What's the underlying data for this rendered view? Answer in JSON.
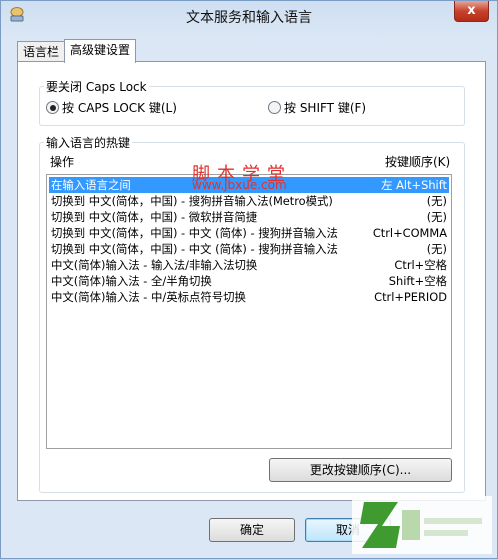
{
  "window": {
    "title": "文本服务和输入语言",
    "close_glyph": "x"
  },
  "tabs": [
    {
      "label": "语言栏",
      "active": false
    },
    {
      "label": "高级键设置",
      "active": true
    }
  ],
  "capslock": {
    "legend": "要关闭 Caps Lock",
    "options": [
      {
        "label": "按 CAPS LOCK 键(L)",
        "checked": true
      },
      {
        "label": "按 SHIFT 键(F)",
        "checked": false
      }
    ]
  },
  "hotkeys": {
    "legend": "输入语言的热键",
    "col_action": "操作",
    "col_key": "按键顺序(K)",
    "rows": [
      {
        "action": "在输入语言之间",
        "key": "左 Alt+Shift",
        "selected": true
      },
      {
        "action": "切换到 中文(简体，中国) - 搜狗拼音输入法(Metro模式)",
        "key": "(无)"
      },
      {
        "action": "切换到 中文(简体，中国) - 微软拼音简捷",
        "key": "(无)"
      },
      {
        "action": "切换到 中文(简体，中国) - 中文 (简体) - 搜狗拼音输入法",
        "key": "Ctrl+COMMA"
      },
      {
        "action": "切换到 中文(简体，中国) - 中文 (简体) - 搜狗拼音输入法",
        "key": "(无)"
      },
      {
        "action": "中文(简体)输入法 - 输入法/非输入法切换",
        "key": "Ctrl+空格"
      },
      {
        "action": "中文(简体)输入法 - 全/半角切换",
        "key": "Shift+空格"
      },
      {
        "action": "中文(简体)输入法 - 中/英标点符号切换",
        "key": "Ctrl+PERIOD"
      }
    ],
    "change_button": "更改按键顺序(C)..."
  },
  "buttons": {
    "ok": "确定",
    "cancel": "取消"
  },
  "watermark": {
    "text": "脚本学堂",
    "url": "www.jbxue.com"
  },
  "colors": {
    "selection": "#3399ff",
    "watermark": "#e0302d"
  },
  "icons": {
    "app": "keyboard-globe-icon",
    "close": "close-icon",
    "logo": "site-logo"
  }
}
